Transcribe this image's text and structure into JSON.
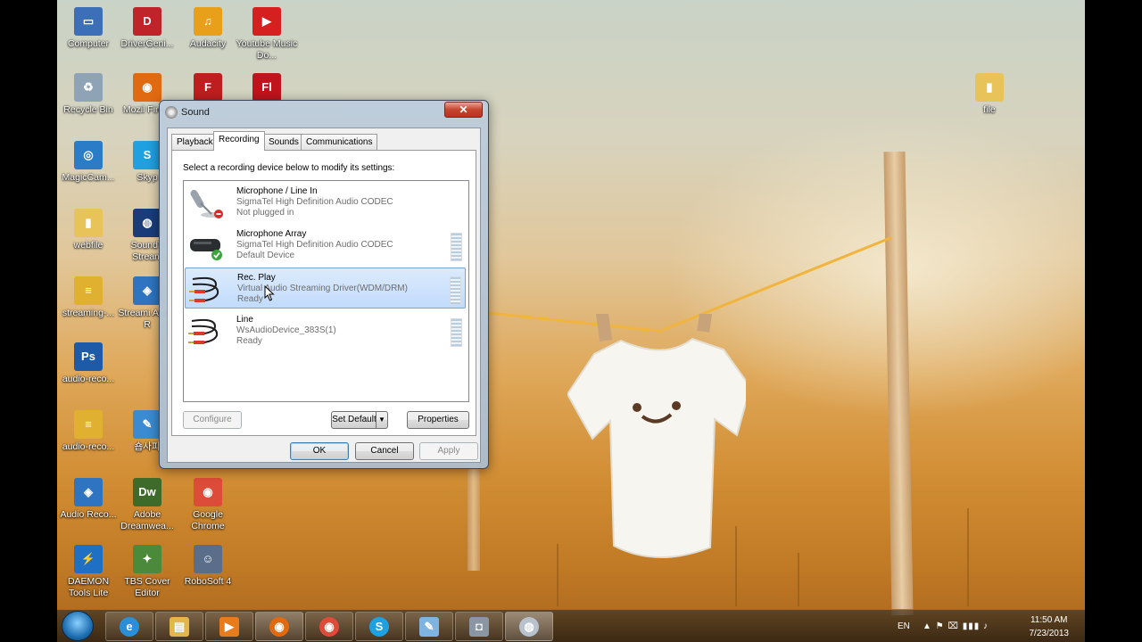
{
  "desktop": {
    "icons": [
      {
        "label": "Computer",
        "icon": "computer-icon",
        "color": "#3d6fb8",
        "glyph": "▭"
      },
      {
        "label": "DriverGeni...",
        "icon": "drivergenius-icon",
        "color": "#c0242b",
        "glyph": "D"
      },
      {
        "label": "Audacity",
        "icon": "audacity-icon",
        "color": "#e8a01a",
        "glyph": "♫"
      },
      {
        "label": "Youtube Music Do...",
        "icon": "youtube-icon",
        "color": "#d62020",
        "glyph": "▶"
      },
      {
        "label": "Recycle Bin",
        "icon": "recycle-bin-icon",
        "color": "#8fa3b6",
        "glyph": "♻"
      },
      {
        "label": "Mozil Firefo",
        "icon": "firefox-icon",
        "color": "#e06a12",
        "glyph": "◉"
      },
      {
        "label": "",
        "icon": "filezilla-icon",
        "color": "#bf1e1e",
        "glyph": "F"
      },
      {
        "label": "",
        "icon": "flash-icon",
        "color": "#c0141c",
        "glyph": "Fl"
      },
      {
        "label": "MagicCam...",
        "icon": "magiccam-icon",
        "color": "#2a7cc7",
        "glyph": "◎"
      },
      {
        "label": "Skyp",
        "icon": "skype-icon",
        "color": "#1fa0e0",
        "glyph": "S"
      },
      {
        "label": "webfile",
        "icon": "folder-icon",
        "color": "#e7c35a",
        "glyph": "▮"
      },
      {
        "label": "SoundT Stream",
        "icon": "soundtap-icon",
        "color": "#1a3d7a",
        "glyph": "◍"
      },
      {
        "label": "streaming-...",
        "icon": "archive-icon",
        "color": "#e0b030",
        "glyph": "≡"
      },
      {
        "label": "Streami Audio R",
        "icon": "streaming-audio-icon",
        "color": "#2f74c0",
        "glyph": "◈"
      },
      {
        "label": "audio-reco...",
        "icon": "photoshop-icon",
        "color": "#1d5aa8",
        "glyph": "Ps"
      },
      {
        "label": "audio-reco...",
        "icon": "archive-icon",
        "color": "#e0b030",
        "glyph": "≡"
      },
      {
        "label": "숍사피",
        "icon": "app-icon",
        "color": "#3a8bd1",
        "glyph": "✎"
      },
      {
        "label": "Audio Reco...",
        "icon": "audio-recorder-icon",
        "color": "#2f74c0",
        "glyph": "◈"
      },
      {
        "label": "Adobe Dreamwea...",
        "icon": "dreamweaver-icon",
        "color": "#3f6b2a",
        "glyph": "Dw"
      },
      {
        "label": "Google Chrome",
        "icon": "chrome-icon",
        "color": "#dd4b39",
        "glyph": "◉"
      },
      {
        "label": "DAEMON Tools Lite",
        "icon": "daemon-tools-icon",
        "color": "#1f6fc4",
        "glyph": "⚡"
      },
      {
        "label": "TBS Cover Editor",
        "icon": "tbs-cover-icon",
        "color": "#4a8a3a",
        "glyph": "✦"
      },
      {
        "label": "RoboSoft 4",
        "icon": "robosoft-icon",
        "color": "#5a6e8a",
        "glyph": "☺"
      },
      {
        "label": "file",
        "icon": "folder-icon",
        "color": "#e7c35a",
        "glyph": "▮"
      }
    ]
  },
  "dialog": {
    "title": "Sound",
    "close_glyph": "✕",
    "tabs": [
      "Playback",
      "Recording",
      "Sounds",
      "Communications"
    ],
    "active_tab": "Recording",
    "instruction": "Select a recording device below to modify its settings:",
    "devices": [
      {
        "name": "Microphone / Line In",
        "desc": "SigmaTel High Definition Audio CODEC",
        "status": "Not plugged in",
        "icon": "microphone-icon",
        "badge": "unplugged-badge-icon"
      },
      {
        "name": "Microphone Array",
        "desc": "SigmaTel High Definition Audio CODEC",
        "status": "Default Device",
        "icon": "microphone-array-icon",
        "badge": "default-check-icon"
      },
      {
        "name": "Rec. Play",
        "desc": "Virtual Audio Streaming Driver(WDM/DRM)",
        "status": "Ready",
        "icon": "rca-cable-icon",
        "badge": ""
      },
      {
        "name": "Line",
        "desc": "WsAudioDevice_383S(1)",
        "status": "Ready",
        "icon": "rca-cable-icon",
        "badge": ""
      }
    ],
    "selected_device": "Rec. Play",
    "buttons": {
      "configure": "Configure",
      "set_default": "Set Default",
      "dropdown_glyph": "▼",
      "properties": "Properties",
      "ok": "OK",
      "cancel": "Cancel",
      "apply": "Apply"
    }
  },
  "taskbar": {
    "items": [
      {
        "icon": "internet-explorer-icon",
        "color": "#2b8ed8",
        "glyph": "e"
      },
      {
        "icon": "file-explorer-icon",
        "color": "#e2b64a",
        "glyph": "▤"
      },
      {
        "icon": "media-player-icon",
        "color": "#e87b1c",
        "glyph": "▶"
      },
      {
        "icon": "firefox-icon",
        "color": "#e06a12",
        "glyph": "◉"
      },
      {
        "icon": "chrome-icon",
        "color": "#dd4b39",
        "glyph": "◉"
      },
      {
        "icon": "skype-icon",
        "color": "#1fa0e0",
        "glyph": "S"
      },
      {
        "icon": "notepad-icon",
        "color": "#7fb3e0",
        "glyph": "✎"
      },
      {
        "icon": "camera-icon",
        "color": "#8a96a4",
        "glyph": "◘"
      },
      {
        "icon": "sound-settings-icon",
        "color": "#b8c2cc",
        "glyph": "◍"
      }
    ],
    "language": "EN",
    "tray_glyphs": "▲  ⚑  ⌧  ▮▮▮  ♪",
    "time": "11:50 AM",
    "date": "7/23/2013"
  }
}
